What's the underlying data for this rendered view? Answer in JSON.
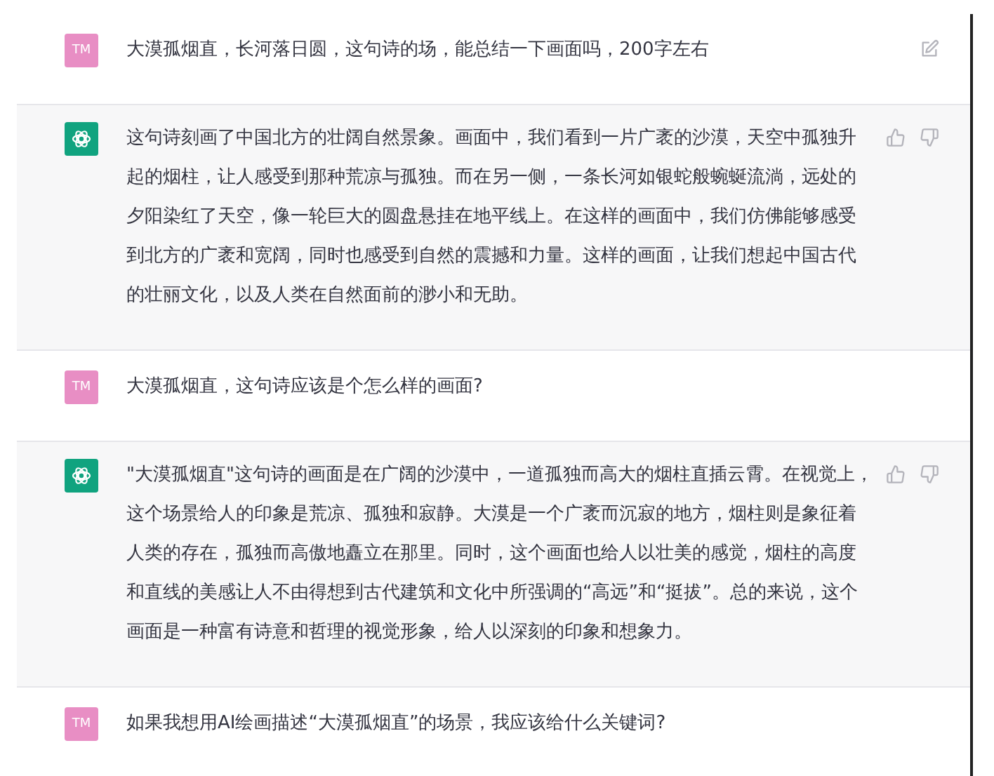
{
  "messages": [
    {
      "kind": "user",
      "avatar": "TM",
      "text": "大漠孤烟直，长河落日圆，这句诗的场，能总结一下画面吗，200字左右",
      "editable": true
    },
    {
      "kind": "assistant",
      "text": "这句诗刻画了中国北方的壮阔自然景象。画面中，我们看到一片广袤的沙漠，天空中孤独升起的烟柱，让人感受到那种荒凉与孤独。而在另一侧，一条长河如银蛇般蜿蜒流淌，远处的夕阳染红了天空，像一轮巨大的圆盘悬挂在地平线上。在这样的画面中，我们仿佛能够感受到北方的广袤和宽阔，同时也感受到自然的震撼和力量。这样的画面，让我们想起中国古代的壮丽文化，以及人类在自然面前的渺小和无助。"
    },
    {
      "kind": "user",
      "avatar": "TM",
      "text": "大漠孤烟直，这句诗应该是个怎么样的画面?",
      "editable": false
    },
    {
      "kind": "assistant",
      "text": "\"大漠孤烟直\"这句诗的画面是在广阔的沙漠中，一道孤独而高大的烟柱直插云霄。在视觉上，这个场景给人的印象是荒凉、孤独和寂静。大漠是一个广袤而沉寂的地方，烟柱则是象征着人类的存在，孤独而高傲地矗立在那里。同时，这个画面也给人以壮美的感觉，烟柱的高度和直线的美感让人不由得想到古代建筑和文化中所强调的“高远”和“挺拔”。总的来说，这个画面是一种富有诗意和哲理的视觉形象，给人以深刻的印象和想象力。"
    },
    {
      "kind": "user",
      "avatar": "TM",
      "text": "如果我想用AI绘画描述“大漠孤烟直”的场景，我应该给什么关键词?",
      "editable": false
    }
  ]
}
